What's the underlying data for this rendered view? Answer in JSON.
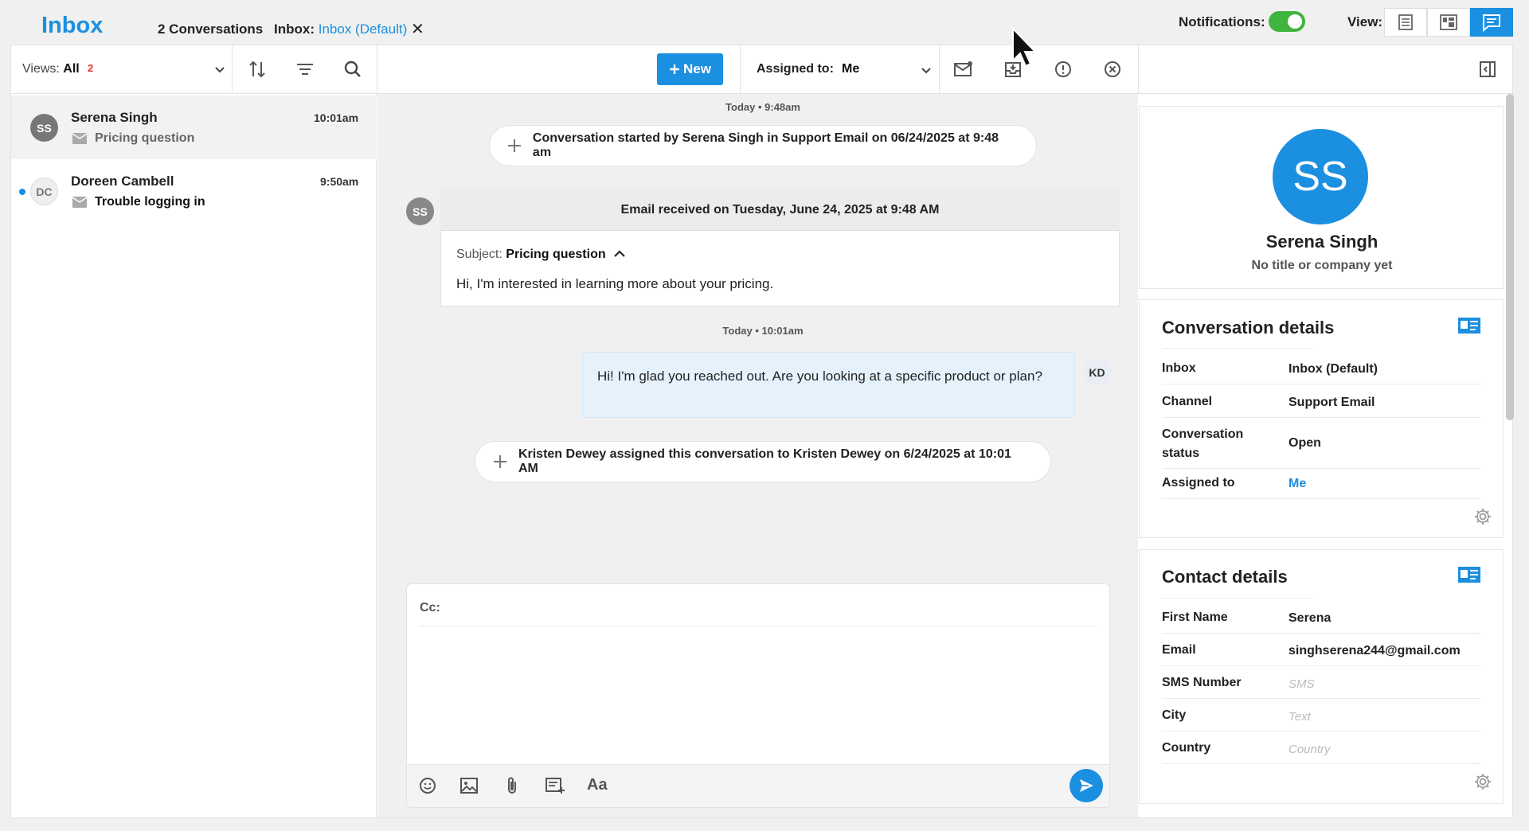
{
  "header": {
    "brand": "Inbox",
    "conversation_count": "2 Conversations",
    "inbox_label": "Inbox:",
    "inbox_value": "Inbox (Default)",
    "close_glyph": "✕",
    "notifications_label": "Notifications:",
    "notifications_on": true,
    "view_label": "View:"
  },
  "toolbar": {
    "views_label": "Views:",
    "views_value": "All",
    "views_badge": "2",
    "new_label": "New",
    "assigned_label": "Assigned to:",
    "assigned_value": "Me"
  },
  "conversations": [
    {
      "initials": "SS",
      "name": "Serena Singh",
      "time": "10:01am",
      "subject": "Pricing question",
      "unread": false,
      "selected": true
    },
    {
      "initials": "DC",
      "name": "Doreen Cambell",
      "time": "9:50am",
      "subject": "Trouble logging in",
      "unread": true,
      "selected": false
    }
  ],
  "thread": {
    "ts1": "Today • 9:48am",
    "event1": "Conversation started by Serena Singh in Support Email on 06/24/2025 at 9:48 am",
    "sender_initials": "SS",
    "email_header": "Email received on Tuesday, June 24, 2025 at 9:48 AM",
    "subject_label": "Subject:",
    "subject_value": "Pricing question",
    "email_body": "Hi, I'm interested in learning more about your pricing.",
    "ts2": "Today • 10:01am",
    "reply_body": "Hi! I'm glad you reached out. Are you looking at a specific product or plan?",
    "reply_initials": "KD",
    "event2": "Kristen Dewey assigned this conversation to Kristen Dewey on 6/24/2025 at 10:01 AM"
  },
  "composer": {
    "cc_label": "Cc:",
    "format_label": "Aa"
  },
  "contact": {
    "initials": "SS",
    "name": "Serena Singh",
    "subtitle": "No title or company yet"
  },
  "conversation_details": {
    "title": "Conversation details",
    "rows": [
      {
        "label": "Inbox",
        "value": "Inbox (Default)"
      },
      {
        "label": "Channel",
        "value": "Support Email"
      },
      {
        "label": "Conversation status",
        "value": "Open"
      },
      {
        "label": "Assigned to",
        "value": "Me"
      }
    ]
  },
  "contact_details": {
    "title": "Contact details",
    "rows": [
      {
        "label": "First Name",
        "value": "Serena",
        "placeholder": ""
      },
      {
        "label": "Email",
        "value": "singhserena244@gmail.com",
        "placeholder": ""
      },
      {
        "label": "SMS Number",
        "value": "",
        "placeholder": "SMS"
      },
      {
        "label": "City",
        "value": "",
        "placeholder": "Text"
      },
      {
        "label": "Country",
        "value": "",
        "placeholder": "Country"
      }
    ]
  },
  "colors": {
    "accent": "#1b8fe0",
    "toggle_on": "#3fb43f",
    "badge": "#e0302f"
  }
}
